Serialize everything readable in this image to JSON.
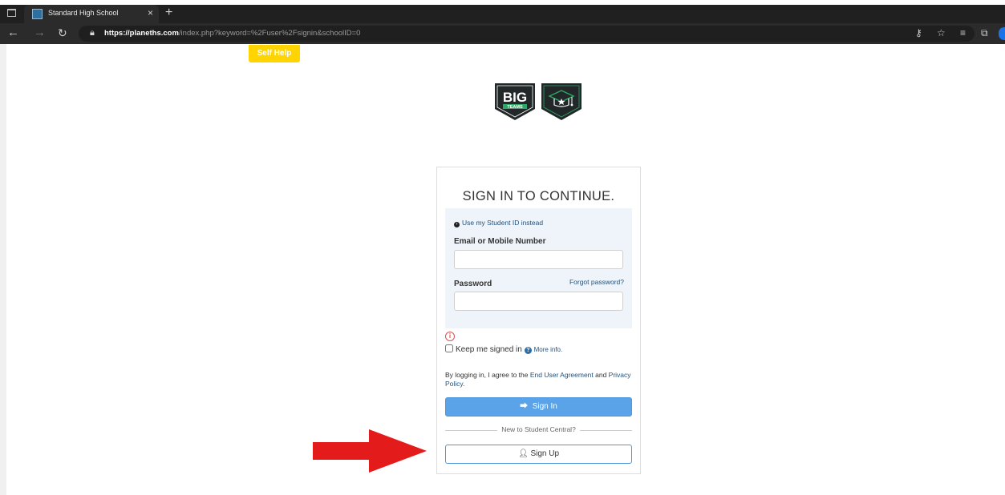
{
  "browser": {
    "tab_title": "Standard High School",
    "tab_close": "×",
    "new_tab": "+",
    "url_host": "https://planeths.com",
    "url_path": "/index.php?keyword=%2Fuser%2Fsignin&schoolID=0"
  },
  "page": {
    "self_help": "Self Help",
    "logo_text_big": "BIG",
    "logo_text_teams": "TEAMS"
  },
  "signin": {
    "title": "SIGN IN TO CONTINUE.",
    "alt_link": "Use my Student ID instead",
    "email_label": "Email or Mobile Number",
    "password_label": "Password",
    "forgot_link": "Forgot password?",
    "warning_glyph": "i",
    "keep_signed_in": "Keep me signed in",
    "more_info": "More info.",
    "agree_prefix": "By logging in, I agree to the ",
    "agree_link1": "End User Agreement",
    "agree_mid": " and ",
    "agree_link2": "Privacy Policy",
    "agree_suffix": ".",
    "sign_in_button": "Sign In",
    "divider_text": "New to Student Central?",
    "sign_up_button": "Sign Up"
  },
  "colors": {
    "self_help_bg": "#ffd400",
    "sign_in_bg": "#5ba3e8",
    "arrow": "#e41b1b",
    "logo_dark": "#22282a",
    "logo_green": "#2ea864"
  }
}
